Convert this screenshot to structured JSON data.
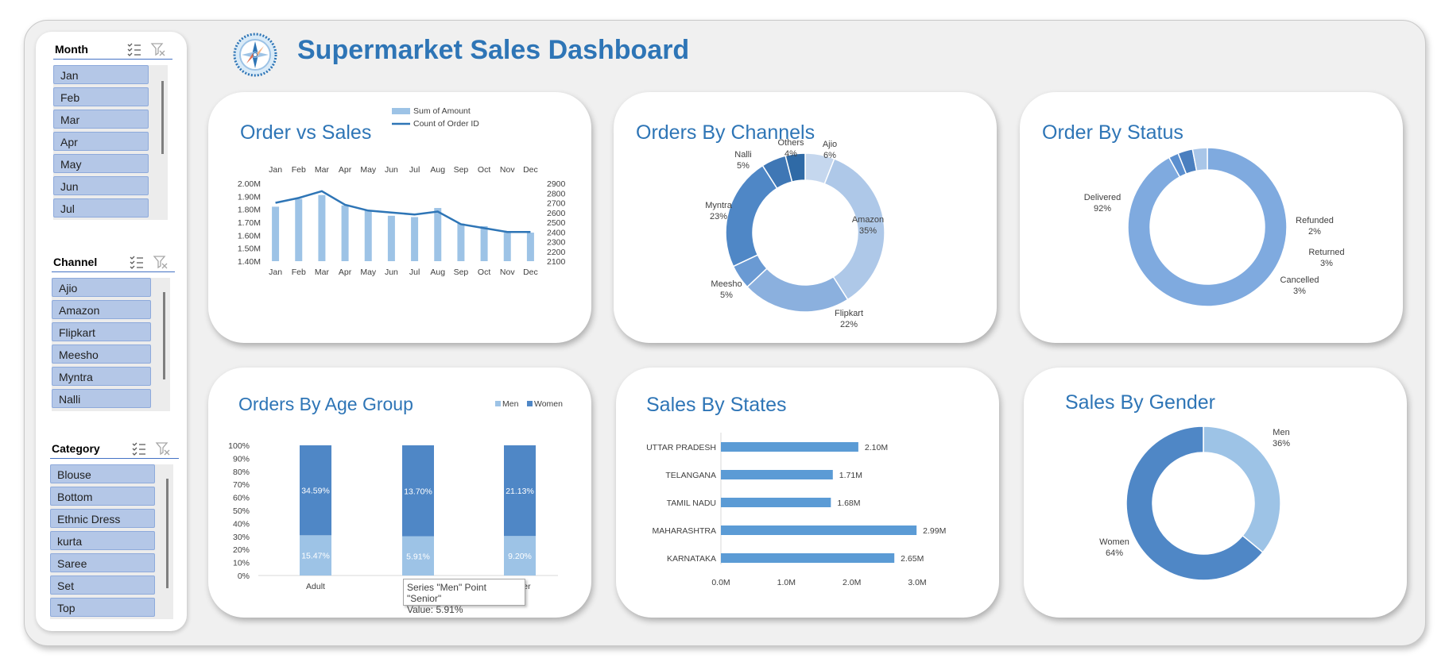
{
  "dashboard": {
    "title": "Supermarket Sales Dashboard"
  },
  "slicers": {
    "month": {
      "title": "Month",
      "items": [
        "Jan",
        "Feb",
        "Mar",
        "Apr",
        "May",
        "Jun",
        "Jul"
      ]
    },
    "channel": {
      "title": "Channel",
      "items": [
        "Ajio",
        "Amazon",
        "Flipkart",
        "Meesho",
        "Myntra",
        "Nalli"
      ]
    },
    "category": {
      "title": "Category",
      "items": [
        "Blouse",
        "Bottom",
        "Ethnic Dress",
        "kurta",
        "Saree",
        "Set",
        "Top"
      ]
    }
  },
  "panels": {
    "order_vs_sales": {
      "title": "Order vs Sales"
    },
    "orders_by_channels": {
      "title": "Orders By Channels"
    },
    "order_by_status": {
      "title": "Order By Status"
    },
    "orders_by_age_group": {
      "title": "Orders By Age Group"
    },
    "sales_by_states": {
      "title": "Sales By States"
    },
    "sales_by_gender": {
      "title": "Sales By Gender"
    }
  },
  "tooltip": {
    "line1": "Series \"Men\" Point \"Senior\"",
    "line2": "Value: 5.91%"
  },
  "colors": {
    "accent": "#2e75b6",
    "bar": "#9dc3e6",
    "line": "#2e75b6",
    "slicer_item": "#b4c7e7"
  },
  "chart_data": [
    {
      "id": "order_vs_sales",
      "type": "bar",
      "title": "Order vs Sales",
      "categories": [
        "Jan",
        "Feb",
        "Mar",
        "Apr",
        "May",
        "Jun",
        "Jul",
        "Aug",
        "Sep",
        "Oct",
        "Nov",
        "Dec"
      ],
      "series": [
        {
          "name": "Sum of Amount",
          "type": "bar",
          "axis": "left",
          "values": [
            1.82,
            1.88,
            1.91,
            1.83,
            1.79,
            1.75,
            1.74,
            1.81,
            1.69,
            1.67,
            1.62,
            1.62
          ]
        },
        {
          "name": "Count of Order ID",
          "type": "line",
          "axis": "right",
          "values": [
            2700,
            2750,
            2820,
            2680,
            2620,
            2600,
            2580,
            2610,
            2480,
            2440,
            2400,
            2400
          ]
        }
      ],
      "y_left": {
        "ticks": [
          "2.00M",
          "1.90M",
          "1.80M",
          "1.70M",
          "1.60M",
          "1.50M",
          "1.40M"
        ],
        "lim": [
          1.4,
          2.0
        ]
      },
      "y_right": {
        "ticks": [
          "2900",
          "2800",
          "2700",
          "2600",
          "2500",
          "2400",
          "2300",
          "2200",
          "2100"
        ],
        "lim": [
          2100,
          2900
        ]
      },
      "legend": "top-right"
    },
    {
      "id": "orders_by_channels",
      "type": "pie",
      "title": "Orders By Channels",
      "labels": [
        "Ajio",
        "Amazon",
        "Flipkart",
        "Meesho",
        "Myntra",
        "Nalli",
        "Others"
      ],
      "values": [
        6,
        35,
        22,
        5,
        23,
        5,
        4
      ],
      "value_labels": [
        "6%",
        "35%",
        "22%",
        "5%",
        "23%",
        "5%",
        "4%"
      ],
      "colors": [
        "#c5d7ee",
        "#aec8e8",
        "#8bb0de",
        "#6a9ad3",
        "#4f87c6",
        "#3f77b5",
        "#2f6aa6"
      ]
    },
    {
      "id": "order_by_status",
      "type": "pie",
      "title": "Order By Status",
      "labels": [
        "Delivered",
        "Refunded",
        "Returned",
        "Cancelled"
      ],
      "values": [
        92,
        2,
        3,
        3
      ],
      "value_labels": [
        "92%",
        "2%",
        "3%",
        "3%"
      ],
      "colors": [
        "#7faadf",
        "#5b8fcf",
        "#4a7fbf",
        "#a9c6e8"
      ]
    },
    {
      "id": "orders_by_age_group",
      "type": "bar",
      "title": "Orders By Age Group",
      "stacked": "percent",
      "categories": [
        "Adult",
        "Senior",
        "Teenager"
      ],
      "series": [
        {
          "name": "Men",
          "values": [
            15.47,
            5.91,
            9.2
          ],
          "labels": [
            "15.47%",
            "5.91%",
            "9.20%"
          ]
        },
        {
          "name": "Women",
          "values": [
            34.59,
            13.7,
            21.13
          ],
          "labels": [
            "34.59%",
            "13.70%",
            "21.13%"
          ]
        }
      ],
      "y_ticks": [
        "100%",
        "90%",
        "80%",
        "70%",
        "60%",
        "50%",
        "40%",
        "30%",
        "20%",
        "10%",
        "0%"
      ],
      "visible_category_labels": [
        "Adult",
        "",
        "ger"
      ],
      "legend": "top-right"
    },
    {
      "id": "sales_by_states",
      "type": "bar",
      "orientation": "horizontal",
      "title": "Sales By States",
      "categories": [
        "UTTAR PRADESH",
        "TELANGANA",
        "TAMIL NADU",
        "MAHARASHTRA",
        "KARNATAKA"
      ],
      "values": [
        2.1,
        1.71,
        1.68,
        2.99,
        2.65
      ],
      "value_labels": [
        "2.10M",
        "1.71M",
        "1.68M",
        "2.99M",
        "2.65M"
      ],
      "x_ticks": [
        "0.0M",
        "1.0M",
        "2.0M",
        "3.0M"
      ],
      "xlim": [
        0,
        3.0
      ]
    },
    {
      "id": "sales_by_gender",
      "type": "pie",
      "title": "Sales By Gender",
      "labels": [
        "Men",
        "Women"
      ],
      "values": [
        36,
        64
      ],
      "value_labels": [
        "36%",
        "64%"
      ],
      "colors": [
        "#9dc3e6",
        "#4f87c6"
      ]
    }
  ]
}
